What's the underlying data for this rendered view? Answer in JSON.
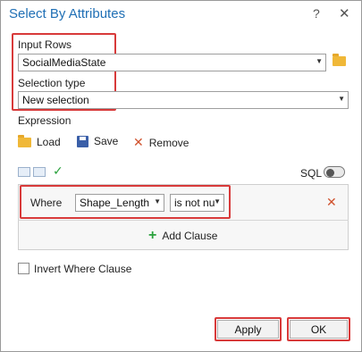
{
  "dialog": {
    "title": "Select By Attributes",
    "help_label": "?",
    "close_label": "✕"
  },
  "input_rows": {
    "label": "Input Rows",
    "value": "SocialMediaState"
  },
  "selection_type": {
    "label": "Selection type",
    "value": "New selection"
  },
  "expression": {
    "label": "Expression",
    "load_label": "Load",
    "save_label": "Save",
    "remove_label": "Remove",
    "sql_label": "SQL",
    "sql_enabled": false
  },
  "clause": {
    "where_label": "Where",
    "field_value": "Shape_Length",
    "operator_value": "is not nu",
    "delete_label": "✕",
    "add_clause_label": "Add Clause"
  },
  "invert": {
    "label": "Invert Where Clause",
    "checked": false
  },
  "buttons": {
    "apply_label": "Apply",
    "ok_label": "OK"
  },
  "colors": {
    "title": "#1f6fb5",
    "highlight_border": "#d83a3a",
    "valid_check": "#2aa13c",
    "add_icon": "#2aa13c",
    "remove_icon": "#d0532f"
  }
}
